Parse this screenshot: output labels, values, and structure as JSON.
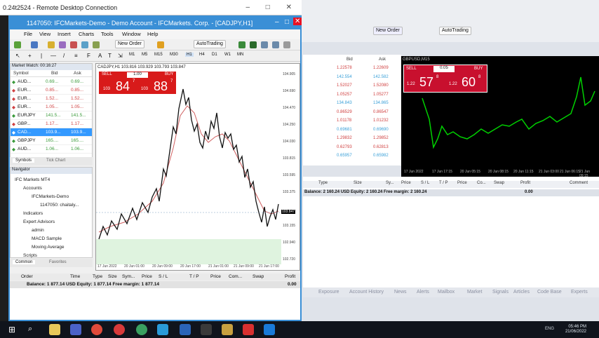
{
  "rdp": {
    "title": "0.24t2524 - Remote Desktop Connection",
    "controls": "–  □  ✕"
  },
  "mt4": {
    "title": "1147050: IFCMarkets-Demo - Demo Account - IFCMarkets. Corp. - [CADJPY,H1]",
    "menu": [
      "File",
      "View",
      "Insert",
      "Charts",
      "Tools",
      "Window",
      "Help"
    ],
    "toolbar": {
      "new_order": "New Order",
      "auto_trading": "AutoTrading",
      "timeframes": [
        "M1",
        "M5",
        "M15",
        "M30",
        "H1",
        "H4",
        "D1",
        "W1",
        "MN"
      ]
    },
    "market_watch": {
      "title": "Market Watch: 00:16:27",
      "columns": [
        "Symbol",
        "Bid",
        "Ask"
      ],
      "rows": [
        {
          "symbol": "AUD...",
          "bid": "0.69...",
          "ask": "0.69..."
        },
        {
          "symbol": "EUR...",
          "bid": "0.85...",
          "ask": "0.85..."
        },
        {
          "symbol": "EUR...",
          "bid": "1.52...",
          "ask": "1.52..."
        },
        {
          "symbol": "EUR...",
          "bid": "1.05...",
          "ask": "1.05..."
        },
        {
          "symbol": "EURJPY",
          "bid": "141.5...",
          "ask": "141.5..."
        },
        {
          "symbol": "GBP...",
          "bid": "1.17...",
          "ask": "1.17..."
        },
        {
          "symbol": "CAD...",
          "bid": "103.9...",
          "ask": "103.9..."
        },
        {
          "symbol": "GBPJPY",
          "bid": "165....",
          "ask": "165...."
        },
        {
          "symbol": "AUD...",
          "bid": "1.06...",
          "ask": "1.06..."
        }
      ],
      "tabs": [
        "Symbols",
        "Tick Chart"
      ]
    },
    "navigator": {
      "title": "Navigator",
      "items": [
        "IFC Markets MT4",
        "Accounts",
        "IFCMarkets-Demo",
        "1147050: chaitaly...",
        "Indicators",
        "Expert Advisors",
        "admin",
        "MACD Sample",
        "Moving Average",
        "Scripts"
      ],
      "tabs": [
        "Common",
        "Favorites"
      ]
    },
    "chart": {
      "symbol_label": "CADJPY,H1",
      "ohlc": "103.816 103.929 103.793 103.847",
      "sell_label": "SELL",
      "buy_label": "BUY",
      "lot": "1.00",
      "sell_price_big": "84",
      "sell_price_small": "103",
      "sell_sup": "7",
      "buy_price_big": "88",
      "buy_price_small": "103",
      "buy_sup": "7",
      "price_ticks": [
        "104.905",
        "104.690",
        "104.470",
        "104.250",
        "104.030",
        "103.815",
        "103.595",
        "103.375",
        "103.155",
        "102.940",
        "102.720"
      ],
      "current_price": "103.847",
      "time_ticks": [
        "17 Jun 2022",
        "20 Jun 01:00",
        "20 Jun 09:00",
        "20 Jun 17:00",
        "21 Jun 01:00",
        "21 Jun 09:00",
        "21 Jun 17:00"
      ]
    },
    "terminal": {
      "columns": [
        "Order",
        "Time",
        "Type",
        "Size",
        "Sym...",
        "Price",
        "S / L",
        "T / P",
        "Price",
        "Com...",
        "Swap",
        "Profit"
      ],
      "balance": "Balance: 1 877.14 USD  Equity: 1 877.14  Free margin: 1 877.14",
      "balance_profit": "0.00"
    }
  },
  "background_terminal": {
    "quote_header": [
      "Bid",
      "Ask"
    ],
    "quotes": [
      [
        "1.22578",
        "1.22609"
      ],
      [
        "142.554",
        "142.582"
      ],
      [
        "1.52027",
        "1.52080"
      ],
      [
        "1.05257",
        "1.05277"
      ],
      [
        "134.843",
        "134.865"
      ],
      [
        "0.86529",
        "0.86547"
      ],
      [
        "1.01178",
        "1.01232"
      ],
      [
        "0.69681",
        "0.69690"
      ],
      [
        "1.29832",
        "1.29852"
      ],
      [
        "0.62793",
        "0.62813"
      ],
      [
        "0.65957",
        "0.65982"
      ]
    ],
    "chart_label": "GBPUSD,M15",
    "sell_label": "SELL",
    "buy_label": "BUY",
    "lot": "0.05",
    "sell_big": "57",
    "sell_small": "1.22",
    "sell_sup": "8",
    "buy_big": "60",
    "buy_small": "1.22",
    "buy_sup": "8",
    "time_ticks": [
      "17 Jun 2022",
      "17 Jun 17:15",
      "20 Jun 05:15",
      "20 Jun 08:15",
      "20 Jun 11:15",
      "21 Jun 03:00",
      "21 Jun 06:15",
      "21 Jun 09:15"
    ],
    "columns": [
      "Type",
      "Size",
      "Sy...",
      "Price",
      "S / L",
      "T / P",
      "Price",
      "Co...",
      "Swap",
      "Profit",
      "Comment"
    ],
    "balance": "Balance: 2 160.24 USD  Equity: 2 160.24  Free margin: 2 160.24",
    "balance_profit": "0.00",
    "tabs": [
      "Exposure",
      "Account History",
      "News",
      "Alerts",
      "Mailbox",
      "Market",
      "Signals",
      "Articles",
      "Code Base",
      "Experts"
    ],
    "new_order": "New Order",
    "auto_trading": "AutoTrading"
  },
  "clock": {
    "time": "05:46 PM",
    "date": "21/06/2022",
    "lang": "ENG"
  }
}
